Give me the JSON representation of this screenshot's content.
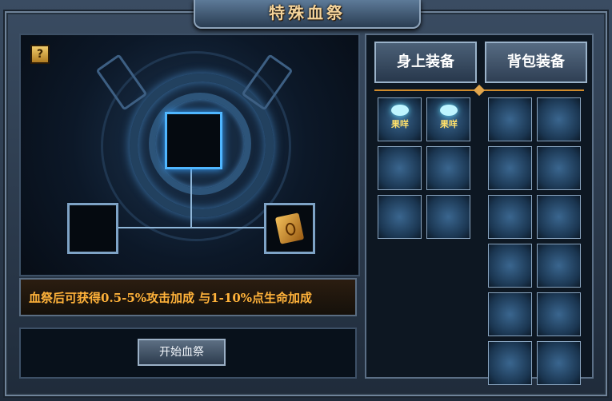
{
  "title": "特殊血祭",
  "help_icon": "help-icon",
  "info_text": "血祭后可获得0.5-5%攻击加成 与1-10%点生命加成",
  "start_button": "开始血祭",
  "tabs": [
    "身上装备",
    "背包装备"
  ],
  "equipped_items": [
    {
      "icon": "gem-icon",
      "label": "果咩"
    },
    {
      "icon": "gem-icon",
      "label": "果咩"
    },
    {
      "icon": "",
      "label": ""
    },
    {
      "icon": "",
      "label": ""
    },
    {
      "icon": "",
      "label": ""
    },
    {
      "icon": "",
      "label": ""
    }
  ],
  "bag_items_count": 12
}
